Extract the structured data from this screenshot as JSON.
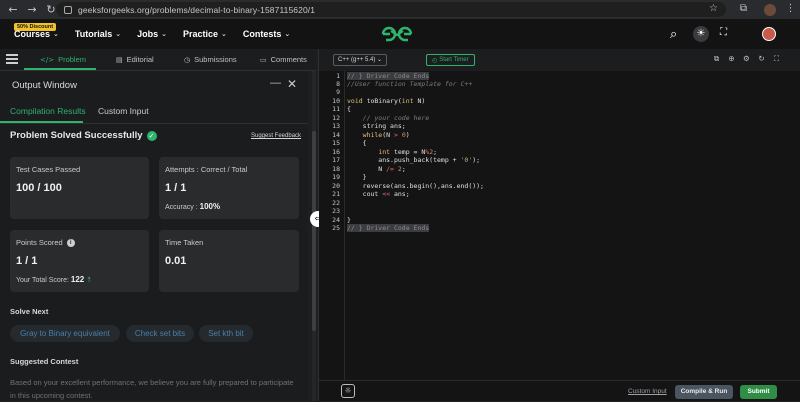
{
  "browser": {
    "url": "geeksforgeeks.org/problems/decimal-to-binary-1587115620/1"
  },
  "header": {
    "discount_badge": "50% Discount",
    "menu": [
      {
        "label": "Courses"
      },
      {
        "label": "Tutorials"
      },
      {
        "label": "Jobs"
      },
      {
        "label": "Practice"
      },
      {
        "label": "Contests"
      }
    ]
  },
  "problem_tabs": [
    {
      "label": "Problem"
    },
    {
      "label": "Editorial"
    },
    {
      "label": "Submissions"
    },
    {
      "label": "Comments"
    }
  ],
  "output": {
    "title": "Output Window",
    "tabs": [
      {
        "label": "Compilation Results"
      },
      {
        "label": "Custom Input"
      }
    ],
    "status": "Problem Solved Successfully",
    "feedback_link": "Suggest Feedback",
    "cards": {
      "test_cases": {
        "label": "Test Cases Passed",
        "value": "100 / 100"
      },
      "attempts": {
        "label": "Attempts : Correct / Total",
        "value": "1 / 1",
        "sub_label": "Accuracy :",
        "sub_value": "100%"
      },
      "points": {
        "label": "Points Scored",
        "value": "1 / 1",
        "sub_label": "Your Total Score:",
        "sub_value": "122"
      },
      "time": {
        "label": "Time Taken",
        "value": "0.01"
      }
    },
    "solve_next_title": "Solve Next",
    "solve_next": [
      {
        "label": "Gray to Binary equivalent"
      },
      {
        "label": "Check set bits"
      },
      {
        "label": "Set kth bit"
      }
    ],
    "suggested_contest_title": "Suggested Contest",
    "suggested_contest_text": "Based on your excellent performance, we believe you are fully prepared to participate in this upcoming contest."
  },
  "editor": {
    "language": "C++ (g++ 5.4)",
    "timer_label": "Start Timer",
    "line_numbers": [
      "1",
      "8",
      "9",
      "10",
      "11",
      "12",
      "13",
      "14",
      "15",
      "16",
      "17",
      "18",
      "19",
      "20",
      "21",
      "22",
      "23",
      "24",
      "25"
    ],
    "code": {
      "l1": "// } Driver Code Ends",
      "l8": "//User function Template for C++",
      "l25": "// } Driver Code Ends"
    },
    "custom_input_link": "Custom Input",
    "compile_button": "Compile & Run",
    "submit_button": "Submit"
  }
}
